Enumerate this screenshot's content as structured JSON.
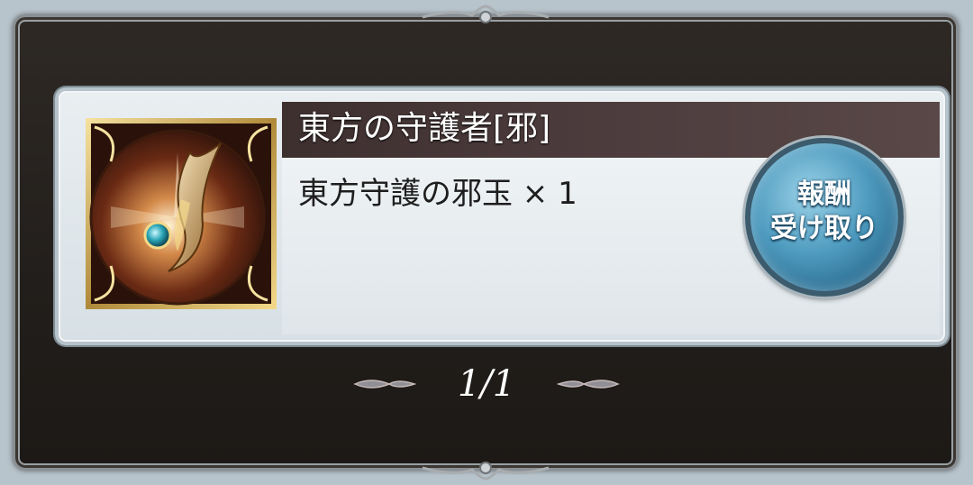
{
  "reward": {
    "title": "東方の守護者[邪]",
    "item_text": "東方守護の邪玉 × 1",
    "item_icon": "evil-orb-icon"
  },
  "claim_button": {
    "line1": "報酬",
    "line2": "受け取り"
  },
  "pager": {
    "label": "1/1",
    "prev_icon": "left-arrow-icon",
    "next_icon": "right-arrow-icon"
  },
  "colors": {
    "frame": "#221e1b",
    "card": "#e3eaee",
    "title_bar": "#4a3a3b",
    "button": "#4e9bbf"
  }
}
